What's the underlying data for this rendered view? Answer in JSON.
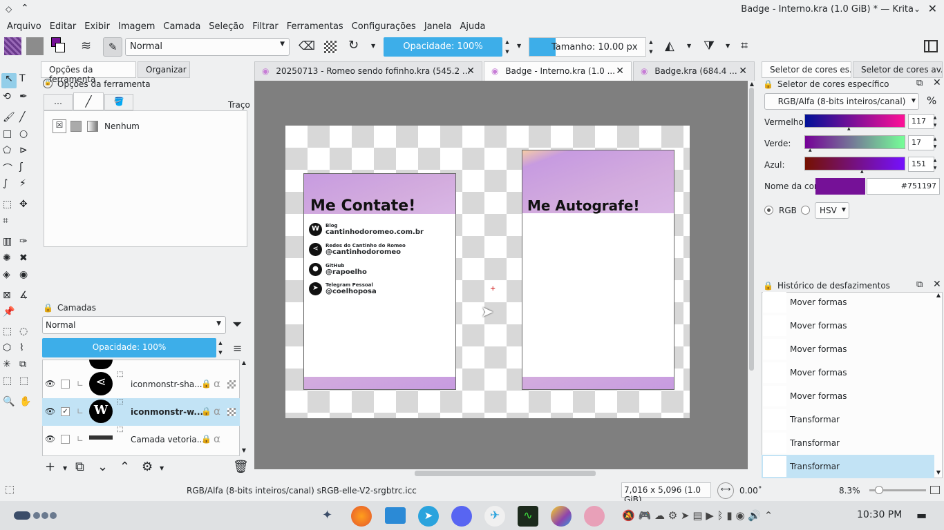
{
  "window": {
    "title": "Badge - Interno.kra (1.0 GiB) * — Krita"
  },
  "menu": [
    "Arquivo",
    "Editar",
    "Exibir",
    "Imagem",
    "Camada",
    "Seleção",
    "Filtrar",
    "Ferramentas",
    "Configurações",
    "Janela",
    "Ajuda"
  ],
  "toolbar": {
    "blend_mode": "Normal",
    "opacity": "Opacidade: 100%",
    "size": "Tamanho: 10.00 px"
  },
  "left_panel": {
    "tabs": [
      "Opções da ferramenta",
      "Organizar"
    ],
    "tool_options_title": "Opções da ferramenta",
    "stroke_label": "Traço",
    "stroke_none": "Nenhum",
    "layers_title": "Camadas",
    "layers_blend": "Normal",
    "layers_opacity": "Opacidade:  100%",
    "layers": [
      {
        "name": "iconmonstr-sha...",
        "checked": false
      },
      {
        "name": "iconmonstr-w...",
        "checked": true,
        "selected": true
      },
      {
        "name": "Camada vetoria...",
        "checked": false
      }
    ]
  },
  "doc_tabs": [
    {
      "label": "20250713 - Romeo sendo fofinho.kra (545.2 ..."
    },
    {
      "label": "Badge - Interno.kra (1.0 ...",
      "active": true
    },
    {
      "label": "Badge.kra (684.4 ..."
    }
  ],
  "canvas": {
    "card1": {
      "title": "Me Contate!",
      "items": [
        {
          "icon": "wordpress-icon",
          "small": "Blog",
          "big": "cantinhodoromeo.com.br"
        },
        {
          "icon": "share-icon",
          "small": "Redes do Cantinho do Romeo",
          "big": "@cantinhodoromeo"
        },
        {
          "icon": "github-icon",
          "small": "GitHub",
          "big": "@rapoelho"
        },
        {
          "icon": "telegram-icon",
          "small": "Telegram Pessoal",
          "big": "@coelhoposa"
        }
      ]
    },
    "card2": {
      "title": "Me Autografe!"
    }
  },
  "right_panel": {
    "tabs": [
      "Seletor de cores es...",
      "Seletor de cores av..."
    ],
    "color_title": "Seletor de cores específico",
    "color_model": "RGB/Alfa (8-bits inteiros/canal)",
    "percent": "%",
    "red_label": "Vermelho:",
    "red": "117",
    "green_label": "Verde:",
    "green": "17",
    "blue_label": "Azul:",
    "blue": "151",
    "color_name_label": "Nome da cor:",
    "hex": "#751197",
    "rgb": "RGB",
    "hsv": "HSV",
    "history_title": "Histórico de desfazimentos",
    "history": [
      "Mover formas",
      "Mover formas",
      "Mover formas",
      "Mover formas",
      "Mover formas",
      "Transformar",
      "Transformar",
      "Transformar"
    ],
    "accent": "#751197"
  },
  "status": {
    "color_space": "RGB/Alfa (8-bits inteiros/canal)  sRGB-elle-V2-srgbtrc.icc",
    "dimensions": "7,016 x 5,096 (1.0 GiB)",
    "rotation": "0.00˚",
    "zoom": "8.3%"
  },
  "taskbar": {
    "clock": "10:30 PM"
  }
}
